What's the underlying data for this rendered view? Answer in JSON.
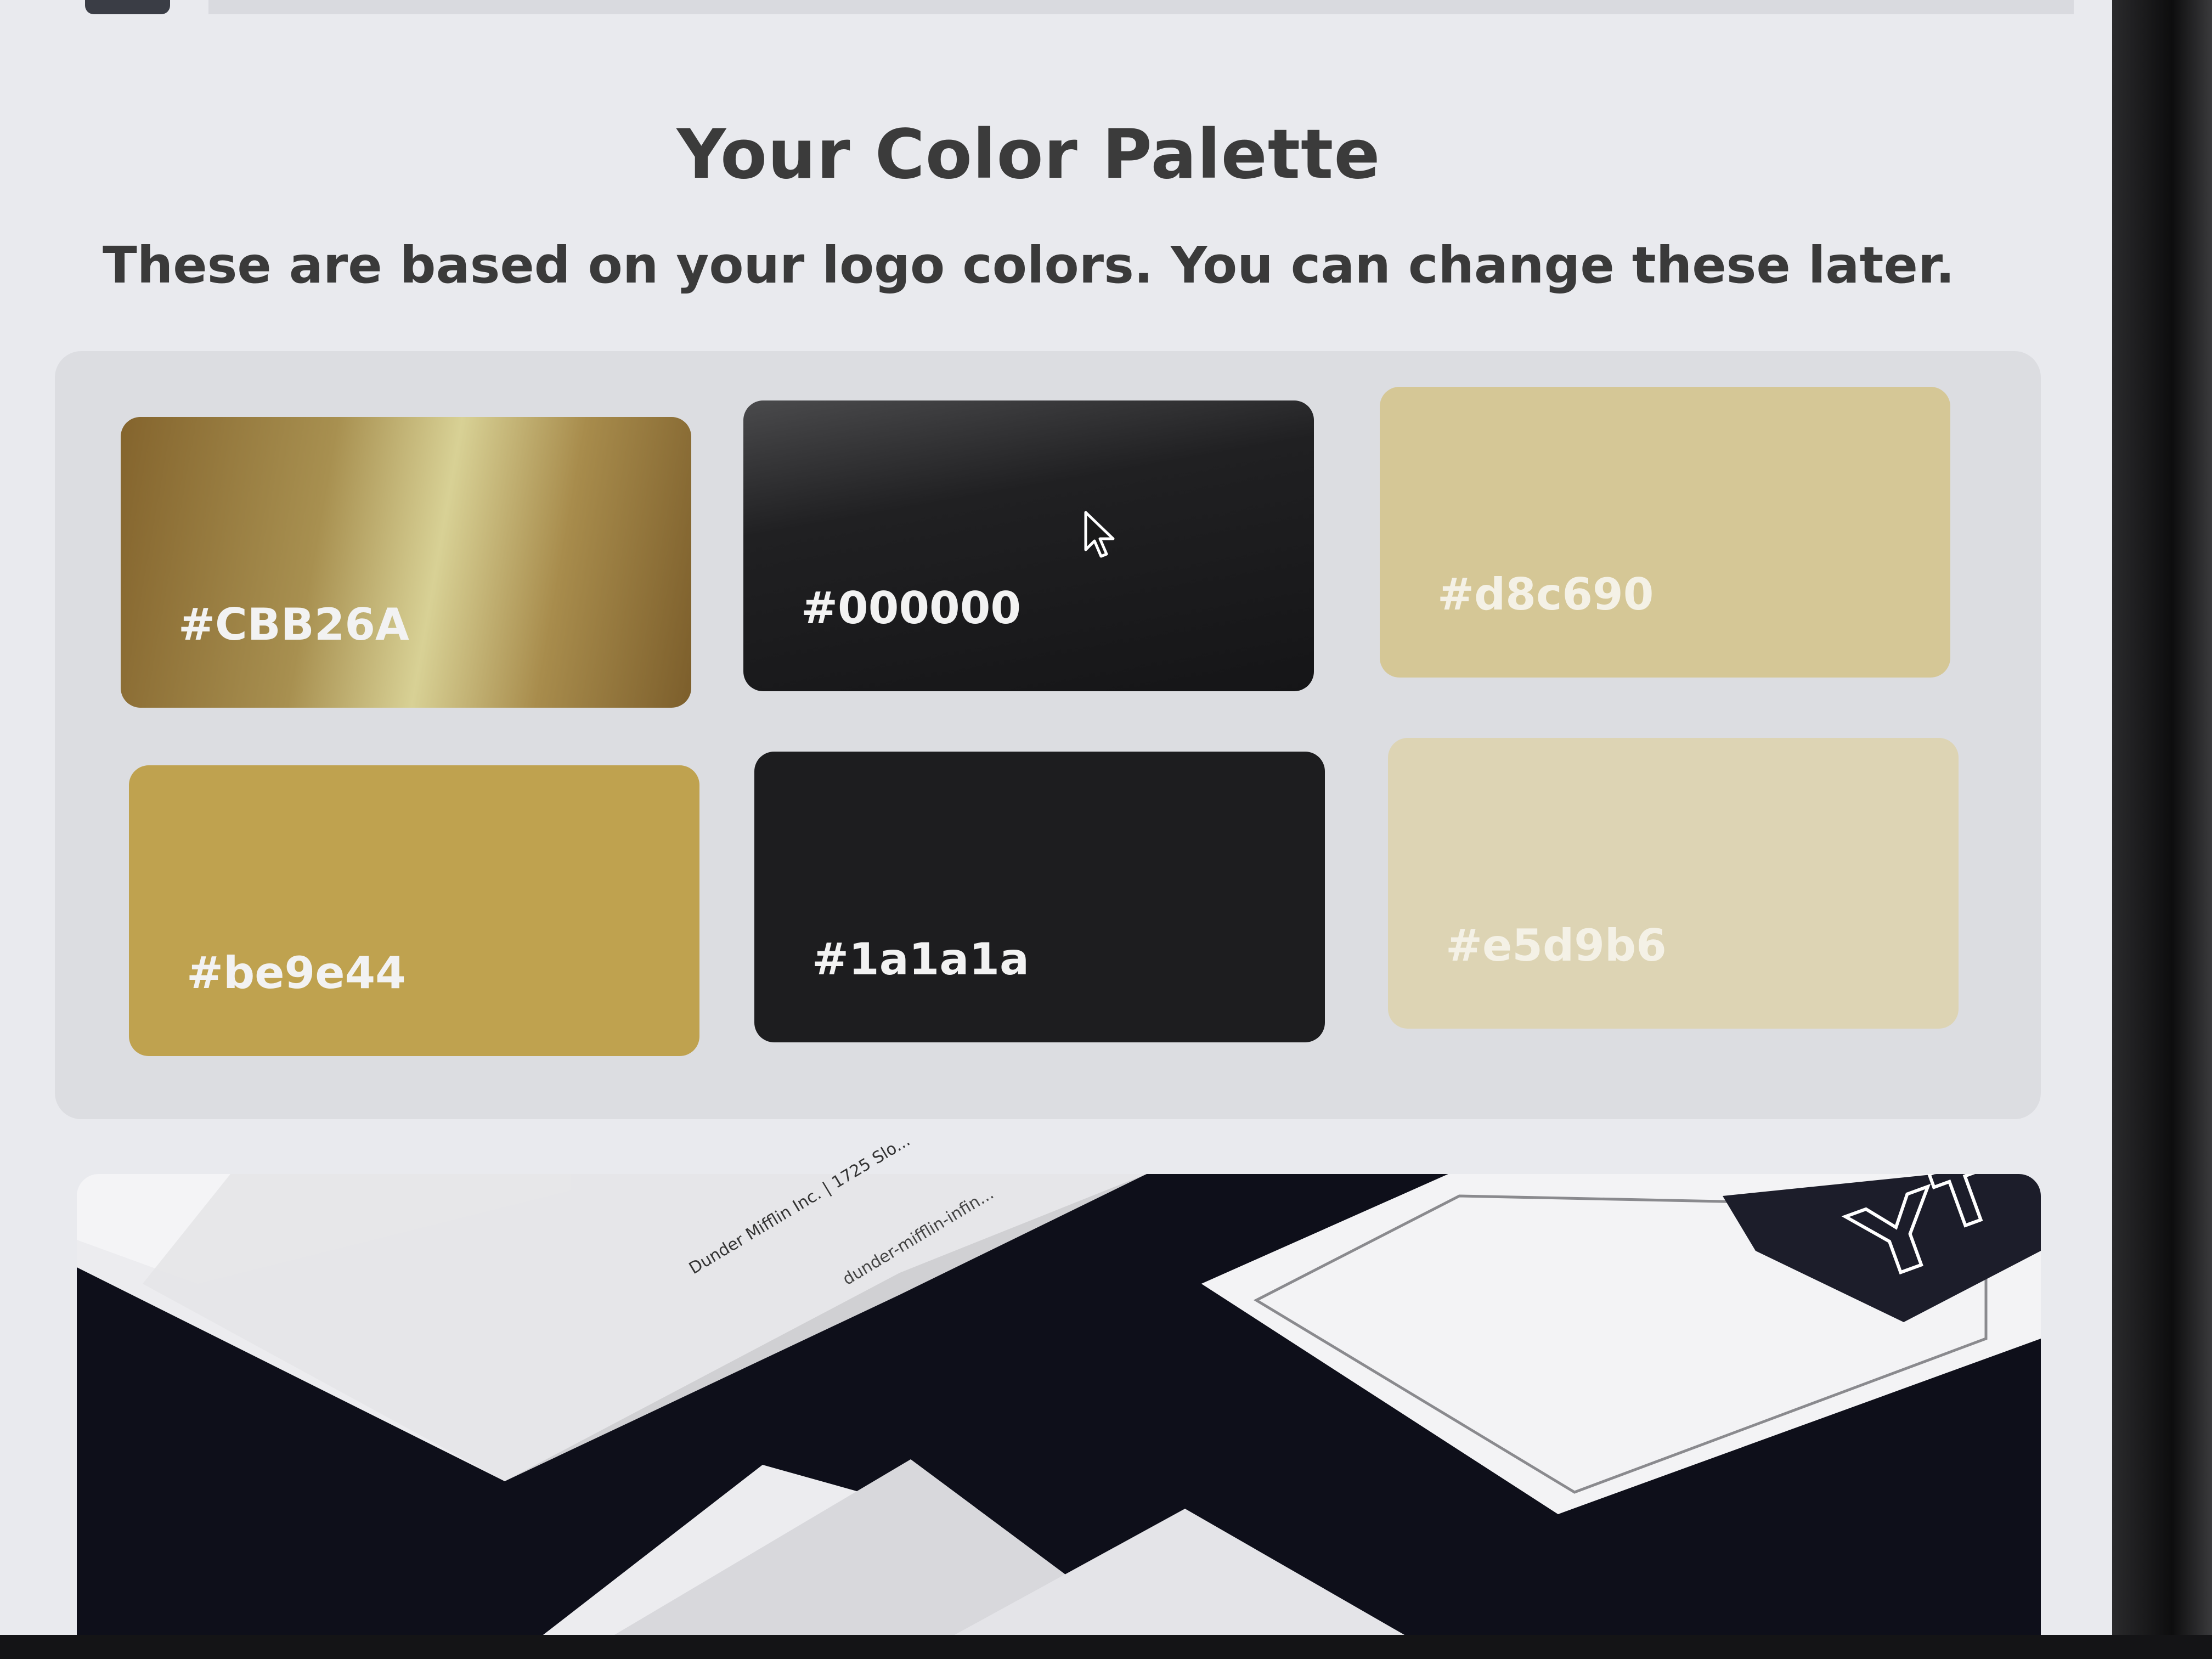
{
  "page": {
    "title": "Your Color Palette",
    "subtitle": "These are based on your logo colors. You can change these later."
  },
  "palette": {
    "swatches": [
      {
        "label": "#CBB26A",
        "color": "#cbb26a"
      },
      {
        "label": "#000000",
        "color": "#000000"
      },
      {
        "label": "#d8c690",
        "color": "#d8c690"
      },
      {
        "label": "#be9e44",
        "color": "#be9e44"
      },
      {
        "label": "#1a1a1a",
        "color": "#1a1a1a"
      },
      {
        "label": "#e5d9b6",
        "color": "#e5d9b6"
      }
    ]
  },
  "preview": {
    "letterhead_line1": "Dunder Mifflin Inc.  |  1725 Slo...",
    "letterhead_line2": "dunder-mifflin-infin..."
  },
  "icons": {
    "cursor": "mouse-pointer-icon",
    "logo": "logo-mark-icon"
  }
}
